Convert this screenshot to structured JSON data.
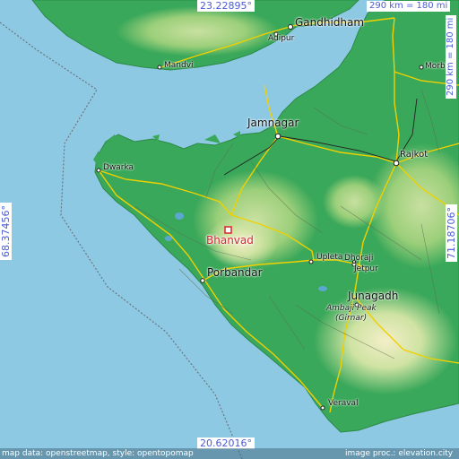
{
  "map": {
    "target": "Bhanvad",
    "cities": {
      "gandhidham": "Gandhidham",
      "adipur": "Adipur",
      "mandvi": "Mandvi",
      "morbi": "Morbi",
      "jamnagar": "Jamnagar",
      "rajkot": "Rajkot",
      "dwarka": "Dwarka",
      "upleta": "Upleta",
      "dhoraji": "Dhoraji",
      "jetpur": "Jetpur",
      "porbandar": "Porbandar",
      "junagadh": "Junagadh",
      "veraval": "Veraval"
    },
    "peak": {
      "line1": "Ambaji Peak",
      "line2": "(Girnar)"
    },
    "coords": {
      "top": "23.22895°",
      "bottom": "20.62016°",
      "left": "68.37456°",
      "right": "71.18706°"
    },
    "scale": {
      "horizontal": "290 km = 180 mi",
      "vertical": "290 km = 180 mi"
    },
    "credits": {
      "left": "map data: openstreetmap, style: opentopomap",
      "right": "image proc.: elevation.city"
    },
    "colors": {
      "sea": "#8ec9e4",
      "lowland": "#3aa85a",
      "highland": "#cfe3a3",
      "road": "#f1d000",
      "target": "#d8262b",
      "coord_text": "#4a5bd6"
    }
  }
}
